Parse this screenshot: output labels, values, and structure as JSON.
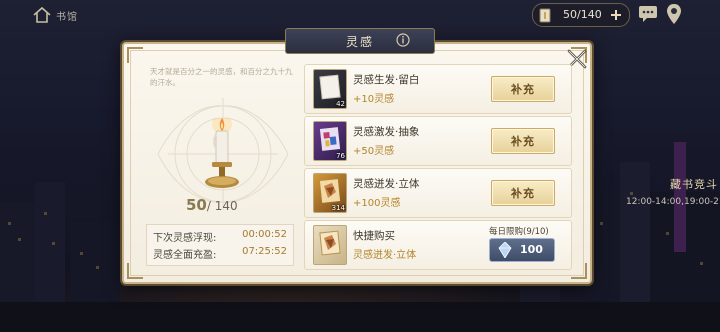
{
  "topbar": {
    "scene_title": "书馆",
    "tickets": "50/140"
  },
  "background_event": {
    "name": "藏书竞斗",
    "time": "12:00-14:00,19:00-21:0"
  },
  "dialog": {
    "title": "灵感",
    "quote": "天才就是百分之一的灵感，和百分之九十九的汗水。",
    "inspiration": {
      "current": "50",
      "max": "/ 140",
      "fill_fraction": 0.357
    },
    "timers": [
      {
        "label": "下次灵感浮现:",
        "value": "00:00:52"
      },
      {
        "label": "灵感全面充盈:",
        "value": "07:25:52"
      }
    ],
    "items": [
      {
        "name": "灵感生发·留白",
        "gain": "+10灵感",
        "count": "42",
        "button": "补充",
        "icon": "blank-card-icon"
      },
      {
        "name": "灵感激发·抽象",
        "gain": "+50灵感",
        "count": "76",
        "button": "补充",
        "icon": "abstract-card-icon"
      },
      {
        "name": "灵感迸发·立体",
        "gain": "+100灵感",
        "count": "314",
        "button": "补充",
        "icon": "cubist-card-icon"
      }
    ],
    "quick_buy": {
      "name": "快捷购买",
      "item": "灵感迸发·立体",
      "limit": "每日限购(9/10)",
      "price": "100",
      "icon": "cubist-card-icon"
    }
  },
  "colors": {
    "panel_bg": "#f5efe3",
    "gold_text": "#b2852a",
    "button_gold": "#e7d19a",
    "title_tab": "#2b2e40",
    "diamond_button": "#3f4c68"
  }
}
